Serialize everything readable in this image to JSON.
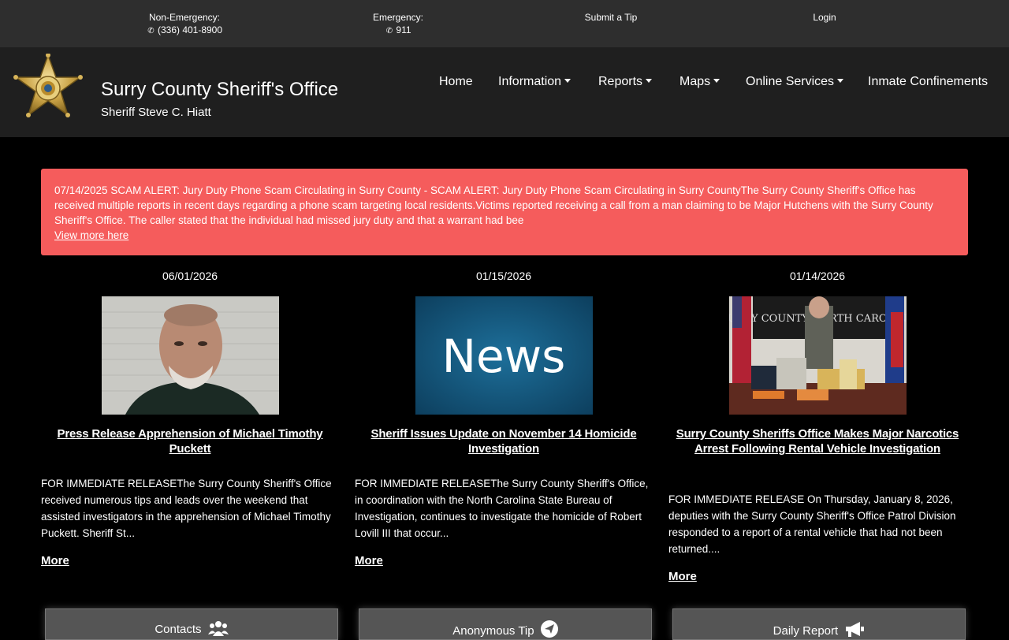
{
  "topbar": {
    "non_emergency_label": "Non-Emergency:",
    "non_emergency_phone": "(336) 401-8900",
    "emergency_label": "Emergency:",
    "emergency_phone": "911",
    "submit_tip": "Submit a Tip",
    "login": "Login"
  },
  "header": {
    "title": "Surry County Sheriff's Office",
    "subtitle": "Sheriff Steve C. Hiatt",
    "badge_text": "SHERIFF"
  },
  "nav": {
    "home": "Home",
    "information": "Information",
    "reports": "Reports",
    "maps": "Maps",
    "online_services": "Online Services",
    "inmate": "Inmate Confinements"
  },
  "alert": {
    "text": "07/14/2025 SCAM ALERT: Jury Duty Phone Scam Circulating in Surry County - SCAM ALERT: Jury Duty Phone Scam Circulating in Surry CountyThe Surry County Sheriff's Office has received multiple reports in recent days regarding a phone scam targeting local residents.Victims reported receiving a call from a man claiming to be Major Hutchens with the Surry County Sheriff's Office. The caller stated that the individual had missed jury duty and that a warrant had bee",
    "link": "View more here",
    "color": "#f55c5c"
  },
  "news": [
    {
      "date": "06/01/2026",
      "headline": "Press Release Apprehension of Michael Timothy Puckett",
      "summary": "FOR IMMEDIATE RELEASEThe Surry County Sheriff's Office received numerous tips and leads over the weekend that assisted investigators in the apprehension of Michael Timothy Puckett. Sheriff St...",
      "more": "More"
    },
    {
      "date": "01/15/2026",
      "headline": "Sheriff Issues Update on November 14 Homicide Investigation",
      "summary": "FOR IMMEDIATE RELEASEThe Surry County Sheriff's Office, in coordination with the North Carolina State Bureau of Investigation, continues to investigate the homicide of Robert Lovill III that occur...",
      "more": "More",
      "image_text": "News"
    },
    {
      "date": "01/14/2026",
      "headline": "Surry County Sheriffs Office Makes Major Narcotics Arrest Following Rental Vehicle Investigation",
      "summary": " FOR IMMEDIATE RELEASE On Thursday, January 8, 2026, deputies with the Surry County Sheriff's Office Patrol Division responded to a report of a rental vehicle that had not been returned....",
      "more": "More",
      "image_text": "SURRY COUNTY NORTH CAROLINA"
    }
  ],
  "buttons": {
    "contacts": "Contacts",
    "anonymous_tip": "Anonymous Tip",
    "daily_report": "Daily Report"
  }
}
